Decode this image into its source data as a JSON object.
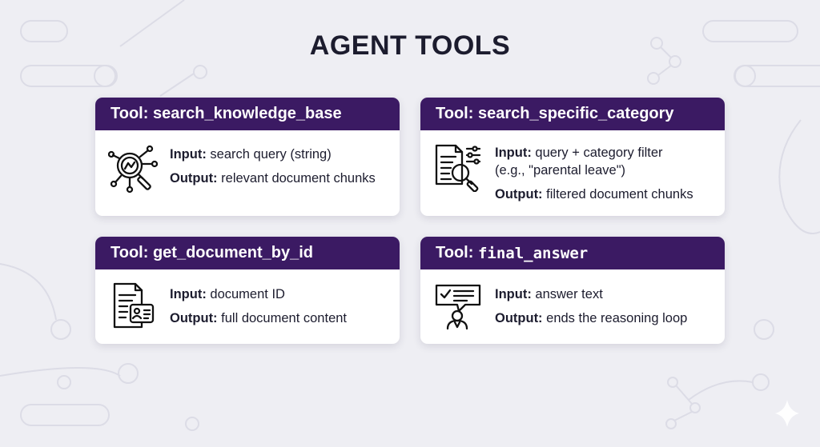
{
  "title": "AGENT TOOLS",
  "colors": {
    "header": "#3b1a63",
    "background": "#eeeef3",
    "card": "#ffffff",
    "text": "#1c1c2e"
  },
  "tools": [
    {
      "prefix": "Tool:",
      "name": "search_knowledge_base",
      "icon": "magnifier-network-icon",
      "input_label": "Input:",
      "input": "search query (string)",
      "output_label": "Output:",
      "output": "relevant document chunks"
    },
    {
      "prefix": "Tool:",
      "name": "search_specific_category",
      "icon": "document-filter-search-icon",
      "input_label": "Input:",
      "input": "query + category filter",
      "input_cont": "(e.g., \"parental leave\")",
      "output_label": "Output:",
      "output": "filtered document chunks"
    },
    {
      "prefix": "Tool:",
      "name": "get_document_by_id",
      "icon": "document-id-card-icon",
      "input_label": "Input:",
      "input": "document ID",
      "output_label": "Output:",
      "output": "full document content"
    },
    {
      "prefix": "Tool:",
      "name": "final_answer",
      "icon": "speech-bubble-person-icon",
      "input_label": "Input:",
      "input": "answer text",
      "output_label": "Output:",
      "output": "ends the reasoning loop"
    }
  ]
}
